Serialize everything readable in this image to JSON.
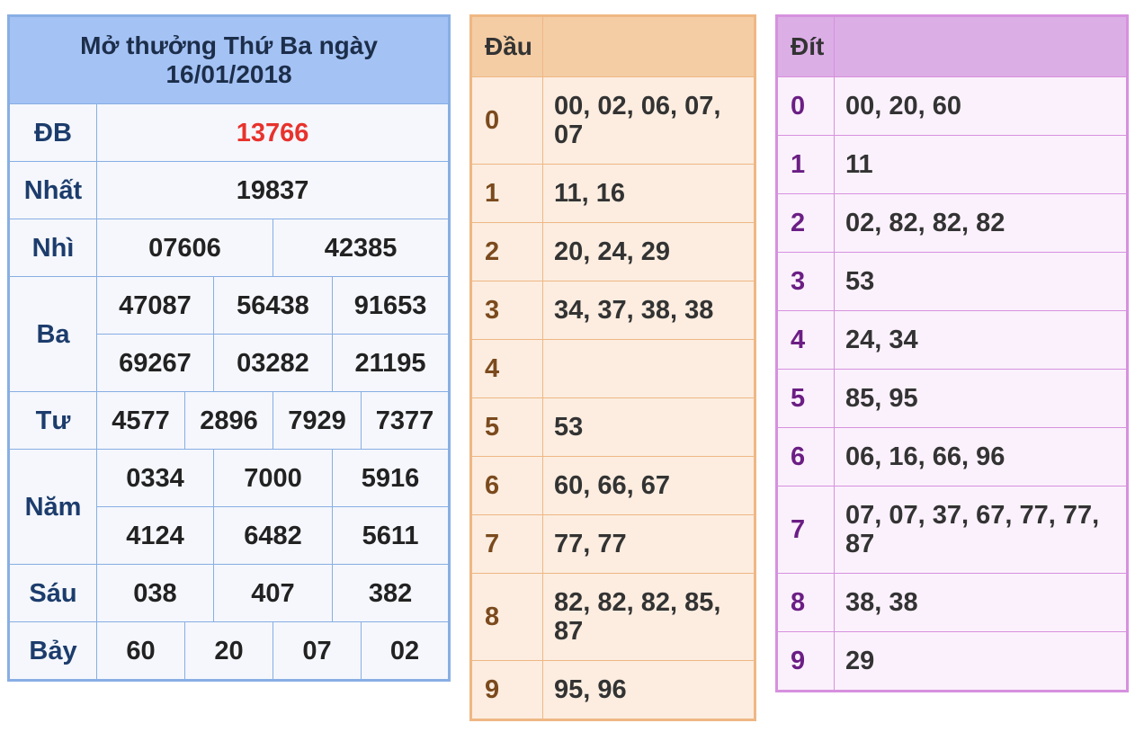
{
  "results": {
    "title_line1": "Mở thưởng Thứ Ba ngày",
    "title_line2": "16/01/2018",
    "rows": [
      {
        "label": "ĐB",
        "values": [
          "13766"
        ]
      },
      {
        "label": "Nhất",
        "values": [
          "19837"
        ]
      },
      {
        "label": "Nhì",
        "values": [
          "07606",
          "42385"
        ]
      },
      {
        "label": "Ba",
        "values": [
          "47087",
          "56438",
          "91653",
          "69267",
          "03282",
          "21195"
        ]
      },
      {
        "label": "Tư",
        "values": [
          "4577",
          "2896",
          "7929",
          "7377"
        ]
      },
      {
        "label": "Năm",
        "values": [
          "0334",
          "7000",
          "5916",
          "4124",
          "6482",
          "5611"
        ]
      },
      {
        "label": "Sáu",
        "values": [
          "038",
          "407",
          "382"
        ]
      },
      {
        "label": "Bảy",
        "values": [
          "60",
          "20",
          "07",
          "02"
        ]
      }
    ]
  },
  "dau": {
    "header": "Đầu",
    "header_value": "",
    "rows": [
      {
        "key": "0",
        "value": "00, 02, 06, 07, 07"
      },
      {
        "key": "1",
        "value": "11, 16"
      },
      {
        "key": "2",
        "value": "20, 24, 29"
      },
      {
        "key": "3",
        "value": "34, 37, 38, 38"
      },
      {
        "key": "4",
        "value": ""
      },
      {
        "key": "5",
        "value": "53"
      },
      {
        "key": "6",
        "value": "60, 66, 67"
      },
      {
        "key": "7",
        "value": "77, 77"
      },
      {
        "key": "8",
        "value": "82, 82, 82, 85, 87"
      },
      {
        "key": "9",
        "value": "95, 96"
      }
    ]
  },
  "dit": {
    "header": "Đít",
    "header_value": "",
    "rows": [
      {
        "key": "0",
        "value": "00, 20, 60"
      },
      {
        "key": "1",
        "value": "11"
      },
      {
        "key": "2",
        "value": "02, 82, 82, 82"
      },
      {
        "key": "3",
        "value": "53"
      },
      {
        "key": "4",
        "value": "24, 34"
      },
      {
        "key": "5",
        "value": "85, 95"
      },
      {
        "key": "6",
        "value": "06, 16, 66, 96"
      },
      {
        "key": "7",
        "value": "07, 07, 37, 67, 77, 77, 87"
      },
      {
        "key": "8",
        "value": "38, 38"
      },
      {
        "key": "9",
        "value": "29"
      }
    ]
  },
  "colors": {
    "results_header": "#a4c2f4",
    "results_border": "#88aee4",
    "special_prize": "#e8322d",
    "dau_header": "#f4cda5",
    "dau_border": "#efb784",
    "dit_header": "#dcaee6",
    "dit_border": "#d691de"
  }
}
